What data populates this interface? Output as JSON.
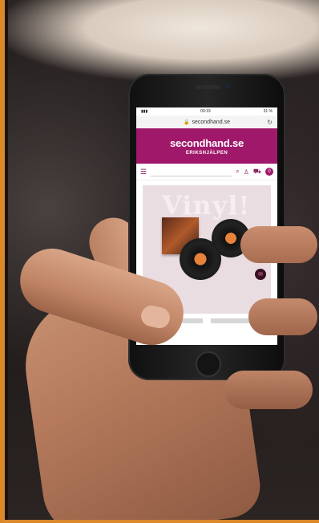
{
  "screen": {
    "status": {
      "time": "09:19",
      "battery": "31 %"
    },
    "url": "secondhand.se",
    "brand": {
      "logo": "secondhand.se",
      "sub": "ERIKSHJÄLPEN"
    },
    "hero": {
      "title": "Vinyl!"
    },
    "cart_count": "0"
  }
}
